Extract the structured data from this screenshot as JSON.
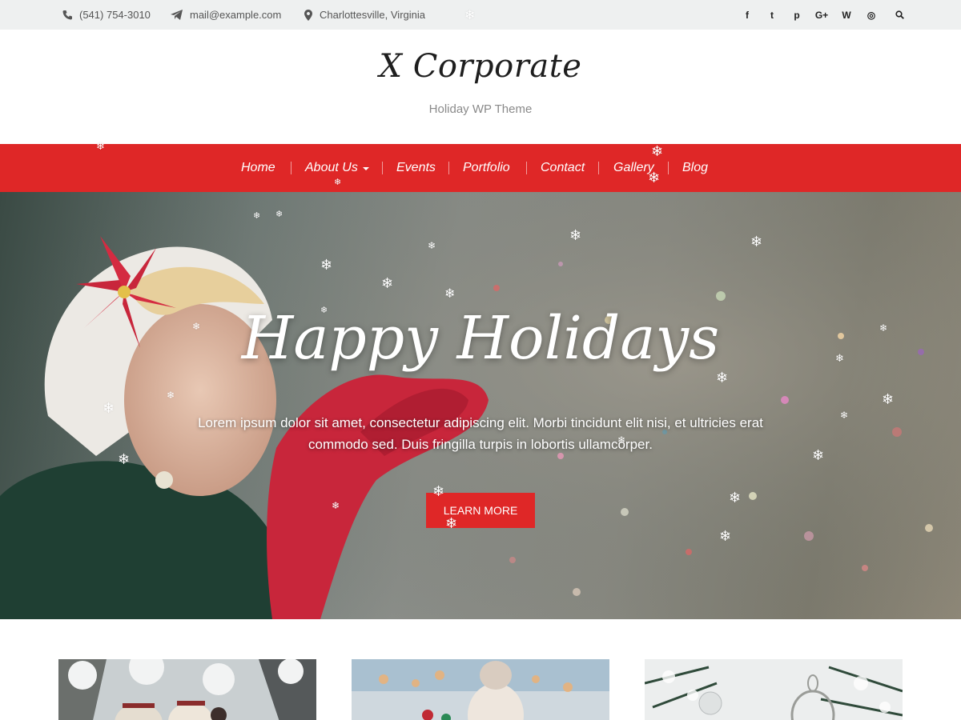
{
  "topbar": {
    "phone": "(541) 754-3010",
    "email": "mail@example.com",
    "location": "Charlottesville, Virginia",
    "social": [
      {
        "icon": "facebook-icon",
        "glyph": "f"
      },
      {
        "icon": "twitter-icon",
        "glyph": "t"
      },
      {
        "icon": "pinterest-icon",
        "glyph": "p"
      },
      {
        "icon": "google-plus-icon",
        "glyph": "G+"
      },
      {
        "icon": "wordpress-icon",
        "glyph": "W"
      },
      {
        "icon": "instagram-icon",
        "glyph": "◎"
      }
    ],
    "search_icon": "search-icon"
  },
  "header": {
    "title": "X Corporate",
    "description": "Holiday WP Theme"
  },
  "nav": {
    "items": [
      {
        "label": "Home"
      },
      {
        "label": "About Us",
        "has_dropdown": true
      },
      {
        "label": "Events"
      },
      {
        "label": "Portfolio"
      },
      {
        "label": "Contact"
      },
      {
        "label": "Gallery"
      },
      {
        "label": "Blog"
      }
    ]
  },
  "hero": {
    "title": "Happy Holidays",
    "text": "Lorem ipsum dolor sit amet, consectetur adipiscing elit. Morbi tincidunt elit nisi, et ultricies erat commodo sed. Duis fringilla turpis in lobortis ullamcorper.",
    "button": "LEARN MORE"
  },
  "colors": {
    "accent": "#df2727",
    "topbar_bg": "#eef0f0",
    "text_muted": "#8a8a8a"
  },
  "snowflake_glyph": "❄"
}
